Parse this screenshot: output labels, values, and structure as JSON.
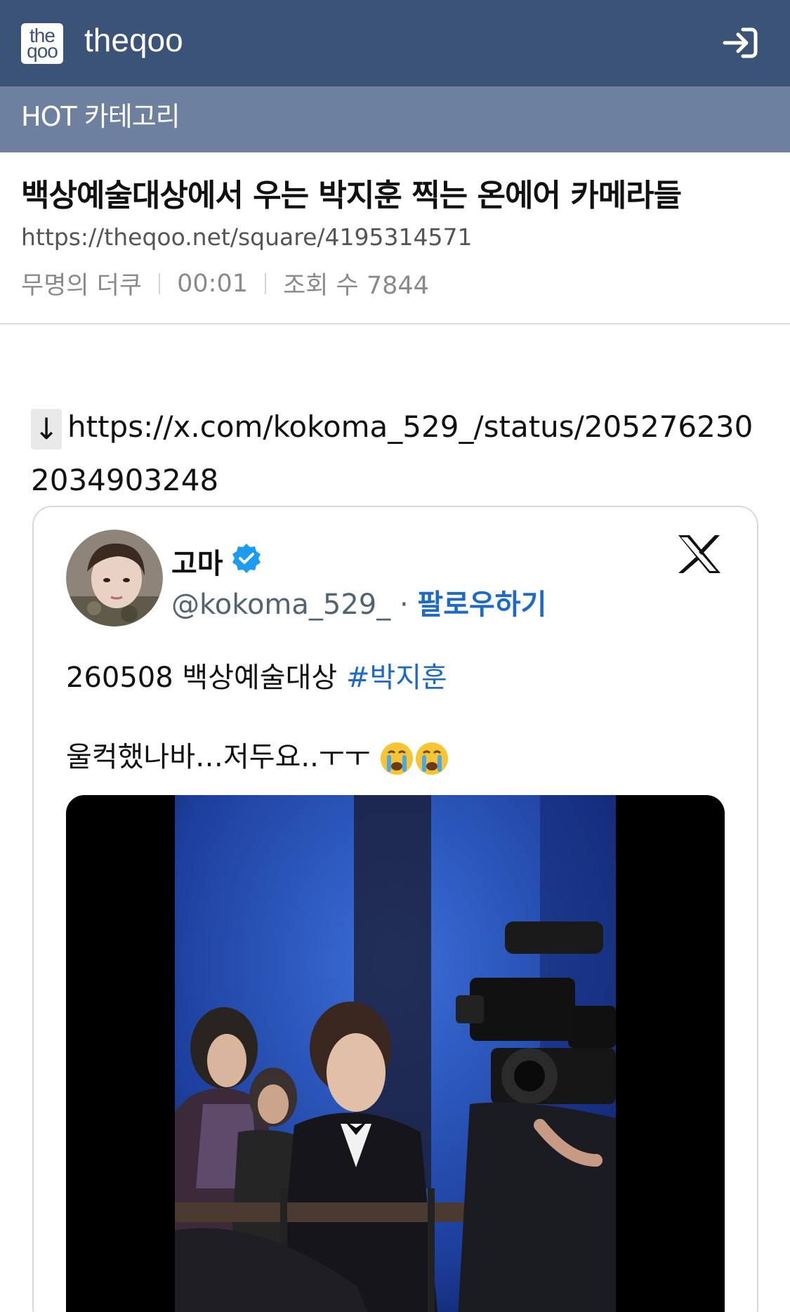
{
  "header": {
    "logo_top": "the",
    "logo_bottom": "qoo",
    "brand": "theqoo",
    "login_icon": "sign-in-icon"
  },
  "category": {
    "label": "HOT 카테고리"
  },
  "post": {
    "title": "백상예술대상에서 우는 박지훈 찍는 온에어 카메라들",
    "url": "https://theqoo.net/square/4195314571",
    "author": "무명의 더쿠",
    "time": "00:01",
    "views": "조회 수 7844"
  },
  "body": {
    "arrow": "↓",
    "link": "https://x.com/kokoma_529_/status/2052762302034903248"
  },
  "tweet": {
    "name": "고마",
    "handle": "@kokoma_529_",
    "separator": " · ",
    "follow": "팔로우하기",
    "line1_text": "260508 백상예술대상 ",
    "line1_hashtag": "#박지훈",
    "line2_text": "울컥했나바…저두요..ㅜㅜ",
    "emojis": [
      "crying-face",
      "crying-face"
    ],
    "colors": {
      "link": "#1d69c7",
      "verified": "#1d9bf0"
    }
  },
  "colors": {
    "header_bg": "#3c5378",
    "category_bg": "#6e80a0"
  }
}
